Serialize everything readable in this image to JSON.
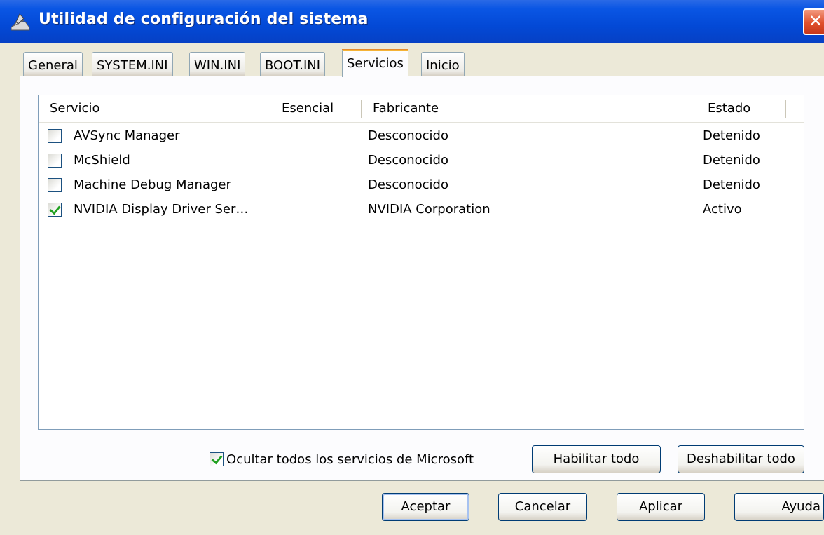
{
  "window": {
    "title": "Utilidad de configuración del sistema"
  },
  "tabs": [
    {
      "label": "General"
    },
    {
      "label": "SYSTEM.INI"
    },
    {
      "label": "WIN.INI"
    },
    {
      "label": "BOOT.INI"
    },
    {
      "label": "Servicios",
      "active": true
    },
    {
      "label": "Inicio"
    }
  ],
  "services": {
    "columns": [
      "Servicio",
      "Esencial",
      "Fabricante",
      "Estado"
    ],
    "rows": [
      {
        "checked": false,
        "name": "AVSync Manager",
        "essential": "",
        "manufacturer": "Desconocido",
        "status": "Detenido"
      },
      {
        "checked": false,
        "name": "McShield",
        "essential": "",
        "manufacturer": "Desconocido",
        "status": "Detenido"
      },
      {
        "checked": false,
        "name": "Machine Debug Manager",
        "essential": "",
        "manufacturer": "Desconocido",
        "status": "Detenido"
      },
      {
        "checked": true,
        "name": "NVIDIA Display Driver Ser…",
        "essential": "",
        "manufacturer": "NVIDIA Corporation",
        "status": "Activo"
      }
    ],
    "hide_microsoft": {
      "label": "Ocultar todos los servicios de Microsoft",
      "checked": true
    },
    "enable_all": "Habilitar todo",
    "disable_all": "Deshabilitar todo"
  },
  "footer": {
    "ok": "Aceptar",
    "cancel": "Cancelar",
    "apply": "Aplicar",
    "help": "Ayuda"
  },
  "colors": {
    "titlebar": "#0349d6",
    "active_tab_accent": "#f5b336",
    "check": "#21a121"
  }
}
